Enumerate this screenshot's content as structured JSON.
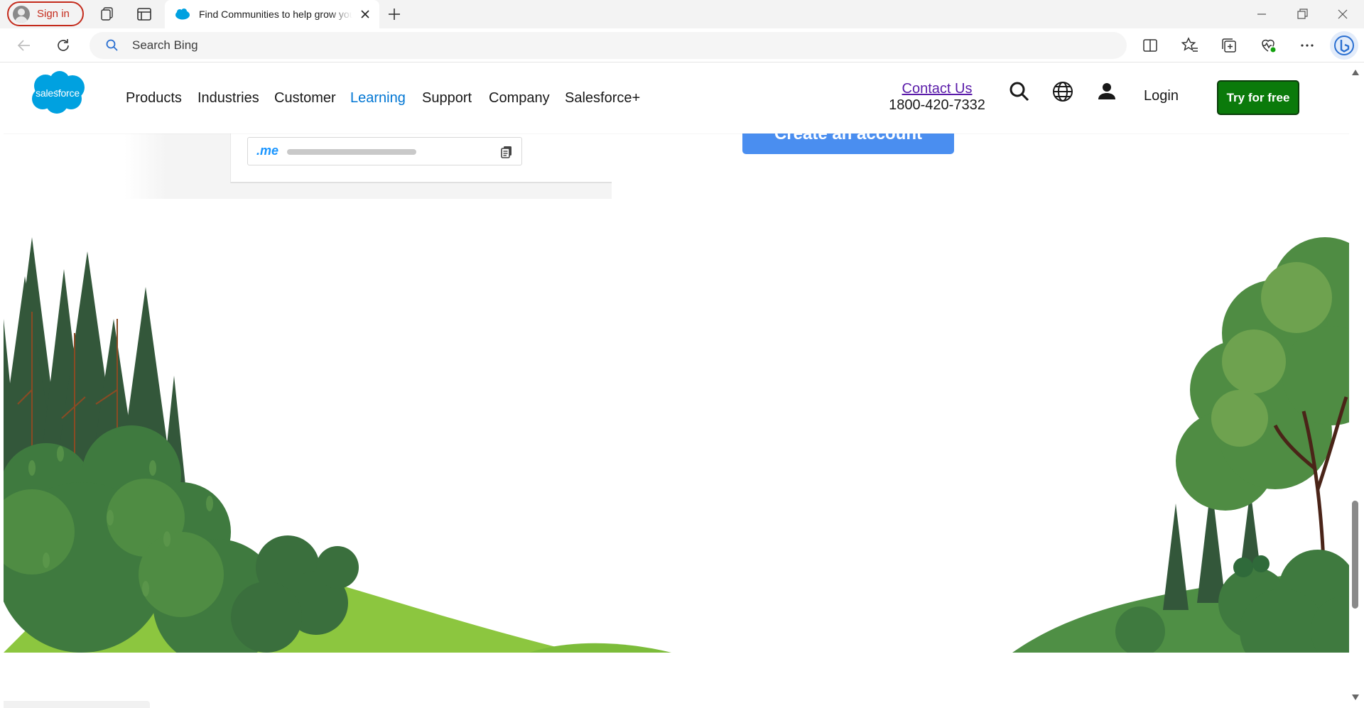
{
  "browser": {
    "signin_label": "Sign in",
    "tab_title": "Find Communities to help grow your business",
    "search_placeholder": "Search Bing"
  },
  "site": {
    "logo_text": "salesforce",
    "nav": [
      "Products",
      "Industries",
      "Customer",
      "Learning",
      "Support",
      "Company",
      "Salesforce+"
    ],
    "active_nav": "Learning",
    "contact_label": "Contact Us",
    "phone": "1800-420-7332",
    "login_label": "Login",
    "try_label": "Try for free"
  },
  "content": {
    "url_prefix": ".me",
    "create_button": "Create an account"
  },
  "colors": {
    "brand_blue": "#00a1e0",
    "active_link": "#0176d3",
    "try_green": "#0b7a0b",
    "signin_red": "#c42b1c",
    "hill_light": "#8cc63f",
    "forest_dark": "#3b5e3b"
  },
  "icons": [
    "workspaces-icon",
    "tab-actions-icon",
    "salesforce-favicon",
    "close-icon",
    "new-tab-icon",
    "minimize-icon",
    "restore-icon",
    "window-close-icon",
    "back-icon",
    "refresh-icon",
    "search-icon",
    "split-screen-icon",
    "favorites-icon",
    "collections-icon",
    "browser-essentials-icon",
    "more-icon",
    "copilot-icon",
    "site-search-icon",
    "globe-icon",
    "user-icon",
    "copy-icon"
  ]
}
